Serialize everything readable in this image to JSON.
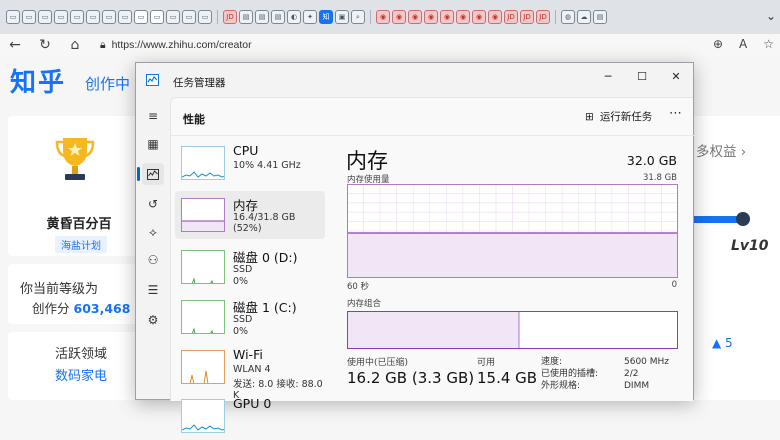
{
  "browser": {
    "tab_icons": [
      {
        "icon": "page-icon",
        "glyph": "▭",
        "style": ""
      },
      {
        "icon": "page-icon",
        "glyph": "▭",
        "style": ""
      },
      {
        "icon": "page-icon",
        "glyph": "▭",
        "style": ""
      },
      {
        "icon": "page-icon",
        "glyph": "▭",
        "style": ""
      },
      {
        "icon": "page-icon",
        "glyph": "▭",
        "style": ""
      },
      {
        "icon": "page-icon",
        "glyph": "▭",
        "style": ""
      },
      {
        "icon": "page-icon",
        "glyph": "▭",
        "style": ""
      },
      {
        "icon": "page-icon",
        "glyph": "▭",
        "style": ""
      },
      {
        "icon": "page-icon",
        "glyph": "▭",
        "style": "sel"
      },
      {
        "icon": "page-icon",
        "glyph": "▭",
        "style": "sel"
      },
      {
        "icon": "page-icon",
        "glyph": "▭",
        "style": ""
      },
      {
        "icon": "page-icon",
        "glyph": "▭",
        "style": ""
      },
      {
        "icon": "page-icon",
        "glyph": "▭",
        "style": ""
      },
      {
        "icon": "jd-icon",
        "glyph": "JD",
        "style": "red"
      },
      {
        "icon": "doc-icon",
        "glyph": "▤",
        "style": ""
      },
      {
        "icon": "doc-icon",
        "glyph": "▤",
        "style": ""
      },
      {
        "icon": "doc-icon",
        "glyph": "▤",
        "style": ""
      },
      {
        "icon": "game-icon",
        "glyph": "◐",
        "style": ""
      },
      {
        "icon": "star-icon",
        "glyph": "✦",
        "style": ""
      },
      {
        "icon": "zhihu-icon",
        "glyph": "知",
        "style": "blue"
      },
      {
        "icon": "image-icon",
        "glyph": "▣",
        "style": ""
      },
      {
        "icon": "search-icon",
        "glyph": "⌕",
        "style": ""
      },
      {
        "icon": "weibo-icon",
        "glyph": "◉",
        "style": "red"
      },
      {
        "icon": "weibo-icon",
        "glyph": "◉",
        "style": "red"
      },
      {
        "icon": "weibo-icon",
        "glyph": "◉",
        "style": "red"
      },
      {
        "icon": "weibo-icon",
        "glyph": "◉",
        "style": "red"
      },
      {
        "icon": "weibo-icon",
        "glyph": "◉",
        "style": "red"
      },
      {
        "icon": "weibo-icon",
        "glyph": "◉",
        "style": "red"
      },
      {
        "icon": "weibo-icon",
        "glyph": "◉",
        "style": "red"
      },
      {
        "icon": "weibo-icon",
        "glyph": "◉",
        "style": "red"
      },
      {
        "icon": "jd-icon",
        "glyph": "JD",
        "style": "red"
      },
      {
        "icon": "jd-icon",
        "glyph": "JD",
        "style": "red"
      },
      {
        "icon": "jd-icon",
        "glyph": "JD",
        "style": "red"
      },
      {
        "icon": "edge-icon",
        "glyph": "◍",
        "style": ""
      },
      {
        "icon": "cloud-icon",
        "glyph": "☁",
        "style": ""
      },
      {
        "icon": "doc-icon",
        "glyph": "▤",
        "style": ""
      }
    ],
    "url": "https://www.zhihu.com/creator"
  },
  "zhihu": {
    "logo": "知乎",
    "subtitle": "创作中",
    "achievement_title": "黄昏百分百",
    "achievement_badge": "海盐计划",
    "level_question": "你当前等级为",
    "score_label": "创作分",
    "score_value": "603,468",
    "area_title": "活跃领域",
    "area_value": "数码家电",
    "more_rights": "多权益",
    "level_text": "Lv10",
    "up_count": "5"
  },
  "task_manager": {
    "title": "任务管理器",
    "heading": "性能",
    "run_task": "运行新任务",
    "devices": [
      {
        "name": "CPU",
        "line1": "10% 4.41 GHz",
        "line2": "",
        "kind": "cpu",
        "selected": false
      },
      {
        "name": "内存",
        "line1": "16.4/31.8 GB (52%)",
        "line2": "",
        "kind": "mem",
        "selected": true
      },
      {
        "name": "磁盘 0 (D:)",
        "line1": "SSD",
        "line2": "0%",
        "kind": "disk",
        "selected": false
      },
      {
        "name": "磁盘 1 (C:)",
        "line1": "SSD",
        "line2": "0%",
        "kind": "disk",
        "selected": false
      },
      {
        "name": "Wi-Fi",
        "line1": "WLAN 4",
        "line2": "发送: 8.0 接收: 88.0 K",
        "kind": "net",
        "selected": false
      },
      {
        "name": "GPU 0",
        "line1": "",
        "line2": "",
        "kind": "cpu",
        "selected": false
      }
    ],
    "memory": {
      "title": "内存",
      "total": "32.0 GB",
      "usage_label": "内存使用量",
      "usage_max": "31.8 GB",
      "axis_left": "60 秒",
      "axis_right": "0",
      "composition_label": "内存组合",
      "usage_fraction": 0.52,
      "in_use_label": "使用中(已压缩)",
      "in_use_value": "16.2 GB (3.3 GB)",
      "available_label": "可用",
      "available_value": "15.4 GB",
      "speed_label": "速度:",
      "speed_value": "5600 MHz",
      "slots_label": "已使用的插槽:",
      "slots_value": "2/2",
      "form_label": "外形规格:",
      "form_value": "DIMM"
    }
  },
  "colors": {
    "zhihu_blue": "#1772f6",
    "mem_line": "#8b3fae",
    "mem_fill": "#f1e6f5",
    "cpu_line": "#1791d1"
  }
}
